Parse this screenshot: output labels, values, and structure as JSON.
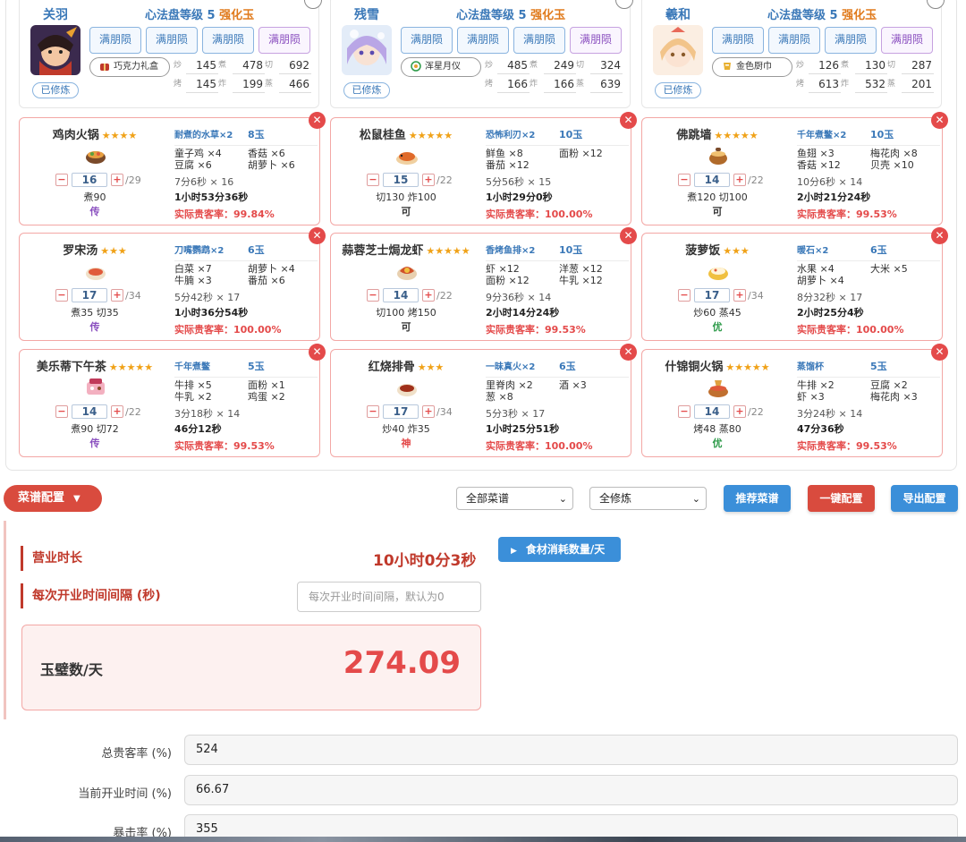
{
  "chefs": [
    {
      "name": "关羽",
      "level_label": "心法盘等级 5",
      "strong_label": "强化玉",
      "trained": "已修炼",
      "tool": "巧克力礼盒",
      "full_buttons": [
        "满朋陨",
        "满朋陨",
        "满朋陨",
        "满朋陨"
      ],
      "stats": [
        [
          "炒",
          "145"
        ],
        [
          "煮",
          "478"
        ],
        [
          "切",
          "692"
        ],
        [
          "烤",
          "145"
        ],
        [
          "炸",
          "199"
        ],
        [
          "蒸",
          "466"
        ]
      ]
    },
    {
      "name": "残雪",
      "level_label": "心法盘等级 5",
      "strong_label": "强化玉",
      "trained": "已修炼",
      "tool": "浑星月仪",
      "full_buttons": [
        "满朋陨",
        "满朋陨",
        "满朋陨",
        "满朋陨"
      ],
      "stats": [
        [
          "炒",
          "485"
        ],
        [
          "煮",
          "249"
        ],
        [
          "切",
          "324"
        ],
        [
          "烤",
          "166"
        ],
        [
          "炸",
          "166"
        ],
        [
          "蒸",
          "639"
        ]
      ]
    },
    {
      "name": "羲和",
      "level_label": "心法盘等级 5",
      "strong_label": "强化玉",
      "trained": "已修炼",
      "tool": "金色厨巾",
      "full_buttons": [
        "满朋陨",
        "满朋陨",
        "满朋陨",
        "满朋陨"
      ],
      "stats": [
        [
          "炒",
          "126"
        ],
        [
          "煮",
          "130"
        ],
        [
          "切",
          "287"
        ],
        [
          "烤",
          "613"
        ],
        [
          "炸",
          "532"
        ],
        [
          "蒸",
          "201"
        ]
      ]
    }
  ],
  "recipes": [
    {
      "name": "鸡肉火锅",
      "stars": "★★★★",
      "equip": "耐煮的水草×2",
      "jade": "8玉",
      "qty": "16",
      "max": "/29",
      "skill": "煮90",
      "grade": "传",
      "grade_color": "#8a4fbf",
      "ings": [
        "童子鸡 ×4",
        "香菇 ×6",
        "豆腐 ×6",
        "胡萝卜 ×6"
      ],
      "time1": "7分6秒 × 16",
      "time2": "1小时53分36秒",
      "rate": "实际贵客率：99.84%",
      "icon": "hotpot"
    },
    {
      "name": "松鼠桂鱼",
      "stars": "★★★★★",
      "equip": "恐怖利刃×2",
      "jade": "10玉",
      "qty": "15",
      "max": "/22",
      "skill": "切130 炸100",
      "grade": "可",
      "grade_color": "#333333",
      "ings": [
        "鲜鱼 ×8",
        "面粉 ×12",
        "番茄 ×12",
        ""
      ],
      "time1": "5分56秒 × 15",
      "time2": "1小时29分0秒",
      "rate": "实际贵客率：100.00%",
      "icon": "fish"
    },
    {
      "name": "佛跳墙",
      "stars": "★★★★★",
      "equip": "千年煮鳖×2",
      "jade": "10玉",
      "qty": "14",
      "max": "/22",
      "skill": "煮120 切100",
      "grade": "可",
      "grade_color": "#333333",
      "ings": [
        "鱼翅 ×3",
        "梅花肉 ×8",
        "香菇 ×12",
        "贝壳 ×10"
      ],
      "time1": "10分6秒 × 14",
      "time2": "2小时21分24秒",
      "rate": "实际贵客率：99.53%",
      "icon": "pot"
    },
    {
      "name": "罗宋汤",
      "stars": "★★★",
      "equip": "刀嘴鹦鹉×2",
      "jade": "6玉",
      "qty": "17",
      "max": "/34",
      "skill": "煮35 切35",
      "grade": "传",
      "grade_color": "#8a4fbf",
      "ings": [
        "白菜 ×7",
        "胡萝卜 ×4",
        "牛腩 ×3",
        "番茄 ×6"
      ],
      "time1": "5分42秒 × 17",
      "time2": "1小时36分54秒",
      "rate": "实际贵客率：100.00%",
      "icon": "soup"
    },
    {
      "name": "蒜蓉芝士焗龙虾",
      "stars": "★★★★★",
      "equip": "香烤鱼排×2",
      "jade": "10玉",
      "qty": "14",
      "max": "/22",
      "skill": "切100 烤150",
      "grade": "可",
      "grade_color": "#333333",
      "ings": [
        "虾 ×12",
        "洋葱 ×12",
        "面粉 ×12",
        "牛乳 ×12"
      ],
      "time1": "9分36秒 × 14",
      "time2": "2小时14分24秒",
      "rate": "实际贵客率：99.53%",
      "icon": "lobster"
    },
    {
      "name": "菠萝饭",
      "stars": "★★★",
      "equip": "暖石×2",
      "jade": "6玉",
      "qty": "17",
      "max": "/34",
      "skill": "炒60 蒸45",
      "grade": "优",
      "grade_color": "#2e9b4a",
      "ings": [
        "水果 ×4",
        "大米 ×5",
        "胡萝卜 ×4",
        ""
      ],
      "time1": "8分32秒 × 17",
      "time2": "2小时25分4秒",
      "rate": "实际贵客率：100.00%",
      "icon": "rice"
    },
    {
      "name": "美乐蒂下午茶",
      "stars": "★★★★★",
      "equip": "千年煮鳖",
      "jade": "5玉",
      "qty": "14",
      "max": "/22",
      "skill": "煮90 切72",
      "grade": "传",
      "grade_color": "#8a4fbf",
      "ings": [
        "牛排 ×5",
        "面粉 ×1",
        "牛乳 ×2",
        "鸡蛋 ×2"
      ],
      "time1": "3分18秒 × 14",
      "time2": "46分12秒",
      "rate": "实际贵客率：99.53%",
      "icon": "tea"
    },
    {
      "name": "红烧排骨",
      "stars": "★★★",
      "equip": "一昧真火×2",
      "jade": "6玉",
      "qty": "17",
      "max": "/34",
      "skill": "炒40 炸35",
      "grade": "神",
      "grade_color": "#e44a4a",
      "ings": [
        "里脊肉 ×2",
        "酒 ×3",
        "葱 ×8",
        ""
      ],
      "time1": "5分3秒 × 17",
      "time2": "1小时25分51秒",
      "rate": "实际贵客率：100.00%",
      "icon": "ribs"
    },
    {
      "name": "什锦铜火锅",
      "stars": "★★★★★",
      "equip": "蒸馏杯",
      "jade": "5玉",
      "qty": "14",
      "max": "/22",
      "skill": "烤48 蒸80",
      "grade": "优",
      "grade_color": "#2e9b4a",
      "ings": [
        "牛排 ×2",
        "豆腐 ×2",
        "虾 ×3",
        "梅花肉 ×3"
      ],
      "time1": "3分24秒 × 14",
      "time2": "47分36秒",
      "rate": "实际贵客率：99.53%",
      "icon": "copperpot"
    }
  ],
  "toolbar": {
    "config_label": "菜谱配置",
    "recipe_filter": "全部菜谱",
    "train_filter": "全修炼",
    "recommend": "推荐菜谱",
    "one_click": "一键配置",
    "export": "导出配置"
  },
  "business": {
    "hours_label": "营业时长",
    "hours_value": "10小时0分3秒",
    "interval_label": "每次开业时间间隔 (秒)",
    "interval_placeholder": "每次开业时间间隔，默认为0",
    "jade_label": "玉璧数/天",
    "jade_value": "274.09",
    "ingredients_button": "食材消耗数量/天"
  },
  "form": [
    {
      "label": "总贵客率 (%)",
      "value": "524"
    },
    {
      "label": "当前开业时间 (%)",
      "value": "66.67"
    },
    {
      "label": "暴击率 (%)",
      "value": "355"
    }
  ],
  "colors": {
    "accent_red": "#d94b3e",
    "accent_blue": "#3b8fd9",
    "link_blue": "#3a78b8",
    "star": "#f0a218"
  }
}
